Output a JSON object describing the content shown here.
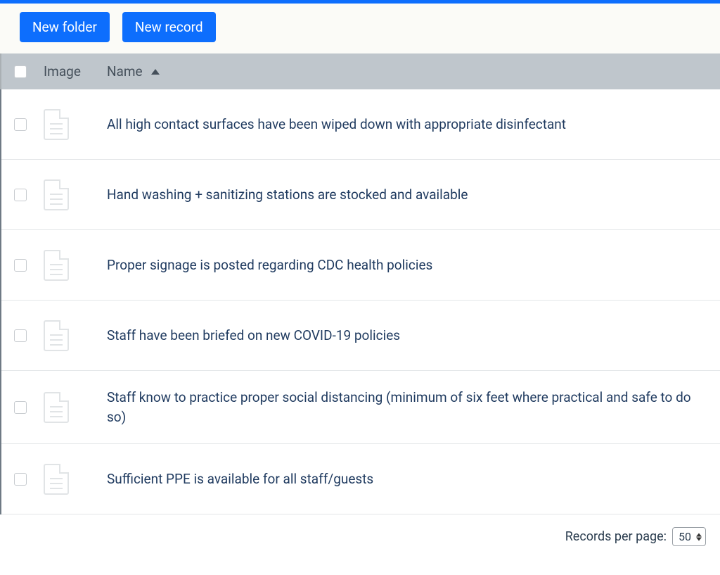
{
  "toolbar": {
    "new_folder_label": "New folder",
    "new_record_label": "New record"
  },
  "columns": {
    "image": "Image",
    "name": "Name"
  },
  "records": [
    {
      "name": "All high contact surfaces have been wiped down with appropriate disinfectant"
    },
    {
      "name": "Hand washing + sanitizing stations are stocked and available"
    },
    {
      "name": "Proper signage is posted regarding CDC health policies"
    },
    {
      "name": "Staff have been briefed on new COVID-19 policies"
    },
    {
      "name": "Staff know to practice proper social distancing (minimum of six feet where practical and safe to do so)"
    },
    {
      "name": "Sufficient PPE is available for all staff/guests"
    }
  ],
  "footer": {
    "records_per_page_label": "Records per page:",
    "records_per_page_value": "50"
  }
}
